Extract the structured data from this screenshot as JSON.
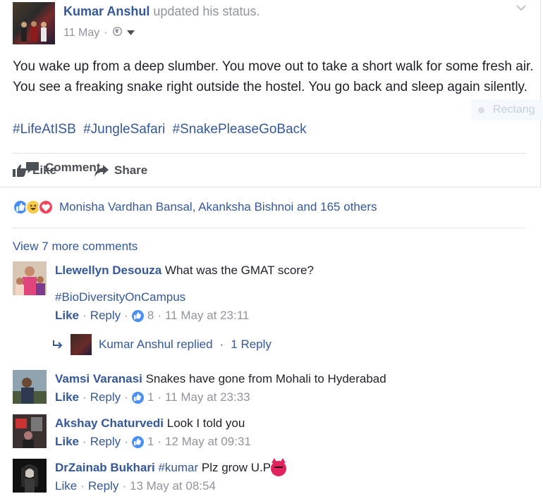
{
  "post": {
    "author": "Kumar Anshul",
    "action": "updated his status.",
    "date": "11 May",
    "separator": "·",
    "text": "You wake up from a deep slumber. You move out to take a short walk for some fresh air. You see a freaking snake right outside the hostel. You go back and sleep again silently.",
    "hashtags": [
      "#LifeAtISB",
      "#JungleSafari",
      "#SnakePleaseGoBack"
    ],
    "side_hint": "Rectang"
  },
  "actions": {
    "like": "Like",
    "comment": "Comment",
    "share": "Share"
  },
  "reactions": {
    "names": "Monisha Vardhan Bansal, Akanksha Bishnoi and 165 others"
  },
  "comments_section": {
    "view_more": "View 7 more comments",
    "comments": [
      {
        "name": "Llewellyn Desouza",
        "text": "What was the GMAT score?",
        "extra": "#BioDiversityOnCampus",
        "like": "Like",
        "reply": "Reply",
        "likes": "8",
        "time": "11 May at 23:11"
      },
      {
        "name": "Vamsi Varanasi",
        "text": "Snakes have gone from Mohali to Hyderabad",
        "like": "Like",
        "reply": "Reply",
        "likes": "1",
        "time": "11 May at 23:33"
      },
      {
        "name": "Akshay Chaturvedi",
        "text": "Look I told you",
        "like": "Like",
        "reply": "Reply",
        "likes": "1",
        "time": "12 May at 09:31"
      },
      {
        "name": "DrZainab Bukhari",
        "tag": "#kumar",
        "text": "Plz grow U.P",
        "like": "Like",
        "reply": "Reply",
        "time": "13 May at 08:54"
      }
    ],
    "reply_summary": {
      "text": "Kumar Anshul replied",
      "count": "1 Reply"
    }
  },
  "colors": {
    "link": "#365899",
    "text": "#1d2129",
    "muted": "#90949c",
    "like_blue": "#4a8ff4"
  }
}
